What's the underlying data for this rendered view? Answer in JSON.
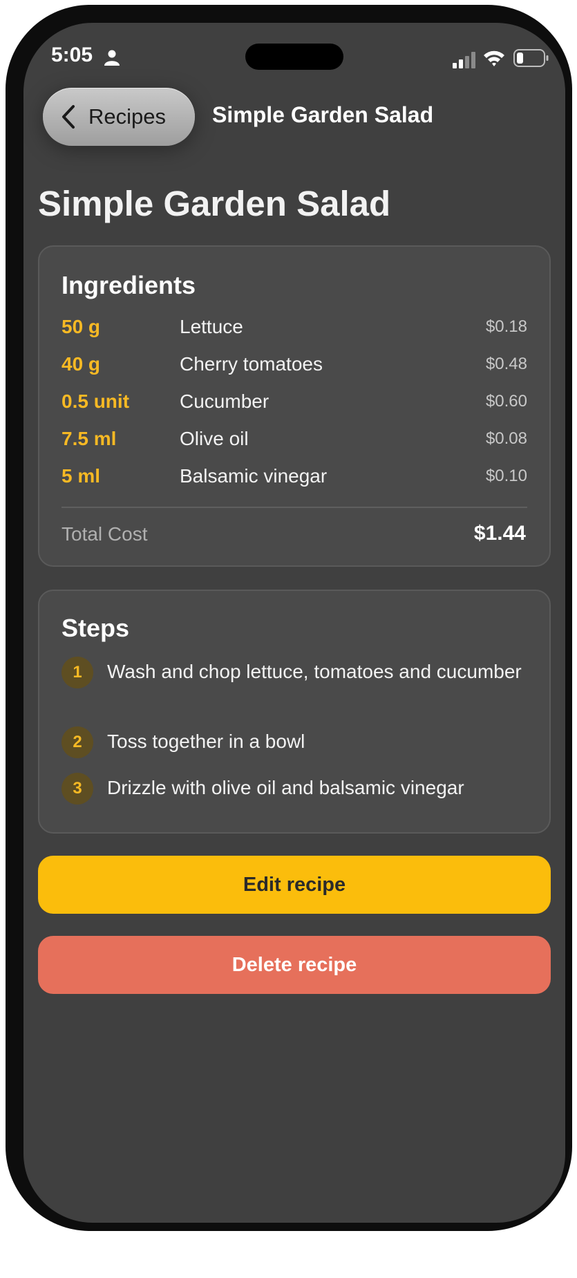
{
  "status_bar": {
    "time": "5:05"
  },
  "nav": {
    "back_label": "Recipes",
    "title": "Simple Garden Salad"
  },
  "page_title": "Simple Garden Salad",
  "ingredients": {
    "heading": "Ingredients",
    "items": [
      {
        "qty": "50 g",
        "name": "Lettuce",
        "cost": "$0.18"
      },
      {
        "qty": "40 g",
        "name": "Cherry tomatoes",
        "cost": "$0.48"
      },
      {
        "qty": "0.5 unit",
        "name": "Cucumber",
        "cost": "$0.60"
      },
      {
        "qty": "7.5 ml",
        "name": "Olive oil",
        "cost": "$0.08"
      },
      {
        "qty": "5 ml",
        "name": "Balsamic vinegar",
        "cost": "$0.10"
      }
    ],
    "total_label": "Total Cost",
    "total_value": "$1.44"
  },
  "steps": {
    "heading": "Steps",
    "items": [
      {
        "num": "1",
        "text": "Wash and chop lettuce, tomatoes and cucumber"
      },
      {
        "num": "2",
        "text": "Toss together in a bowl"
      },
      {
        "num": "3",
        "text": "Drizzle with olive oil and balsamic vinegar"
      }
    ]
  },
  "actions": {
    "edit_label": "Edit recipe",
    "delete_label": "Delete recipe"
  },
  "colors": {
    "accent": "#f7b924",
    "edit_button": "#fbbd0c",
    "delete_button": "#e6705b",
    "screen_background": "#404040",
    "card_background": "#4a4a4a"
  }
}
